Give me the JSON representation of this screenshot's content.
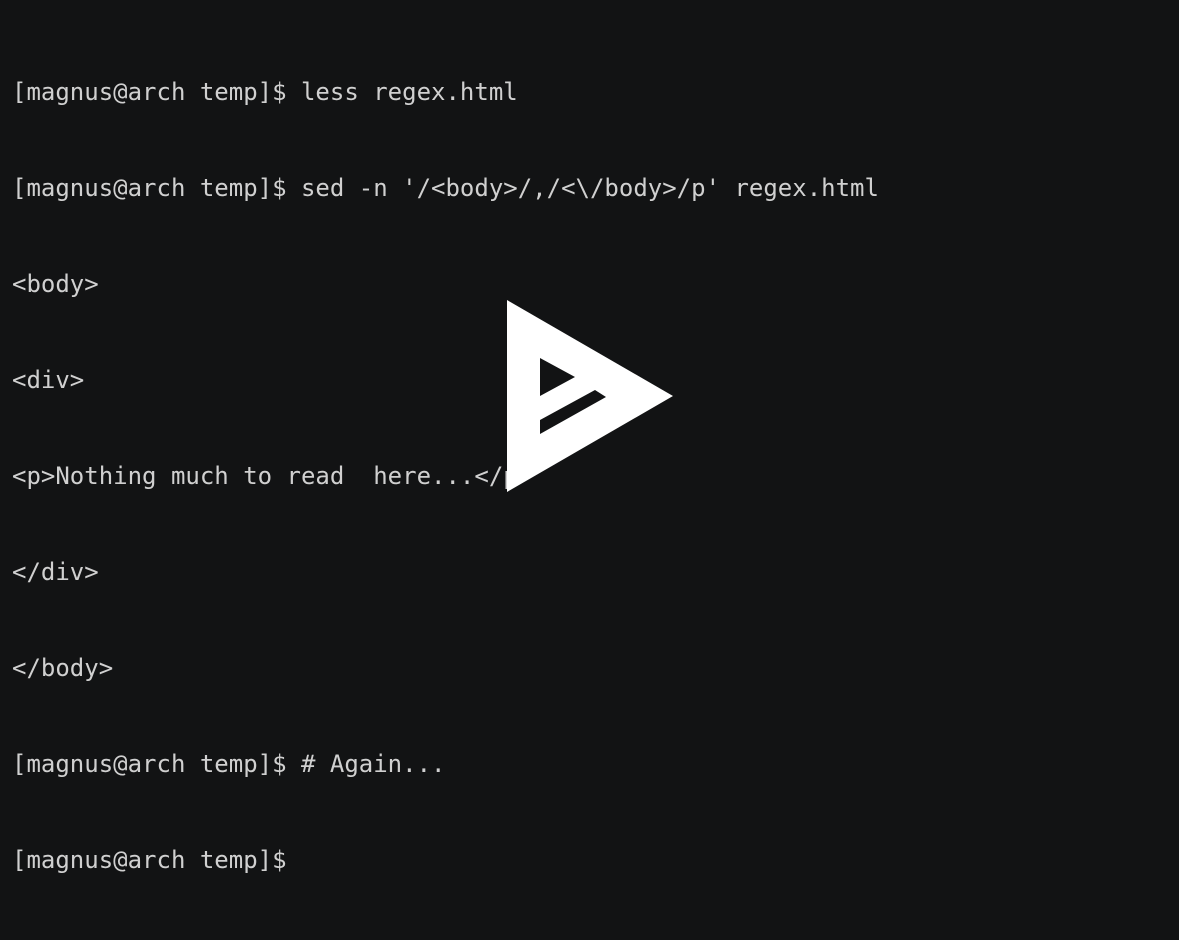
{
  "terminal": {
    "lines": [
      "[magnus@arch temp]$ less regex.html",
      "[magnus@arch temp]$ sed -n '/<body>/,/<\\/body>/p' regex.html",
      "<body>",
      "<div>",
      "<p>Nothing much to read  here...</p>",
      "</div>",
      "</body>",
      "[magnus@arch temp]$ # Again...",
      "[magnus@arch temp]$ "
    ]
  },
  "player": {
    "icon": "asciinema-play-icon",
    "colors": {
      "background": "#121314",
      "foreground": "#d0d0d0",
      "icon": "#ffffff"
    }
  }
}
